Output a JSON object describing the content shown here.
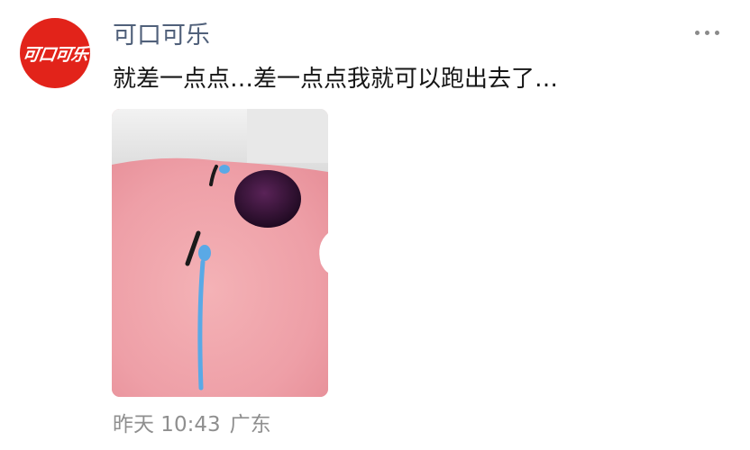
{
  "post": {
    "author": "可口可乐",
    "avatar_logo_text": "可口可乐",
    "text": "就差一点点…差一点点我就可以跑出去了…",
    "time": "昨天 10:43",
    "location": "广东"
  },
  "icons": {
    "more": "more-horizontal-icon"
  },
  "colors": {
    "avatar_bg": "#e2231a",
    "author_name": "#50607a",
    "meta_text": "#8f8f8f",
    "photo_skin": "#f0a7ad",
    "sperm_blue": "#5aa9e6"
  }
}
